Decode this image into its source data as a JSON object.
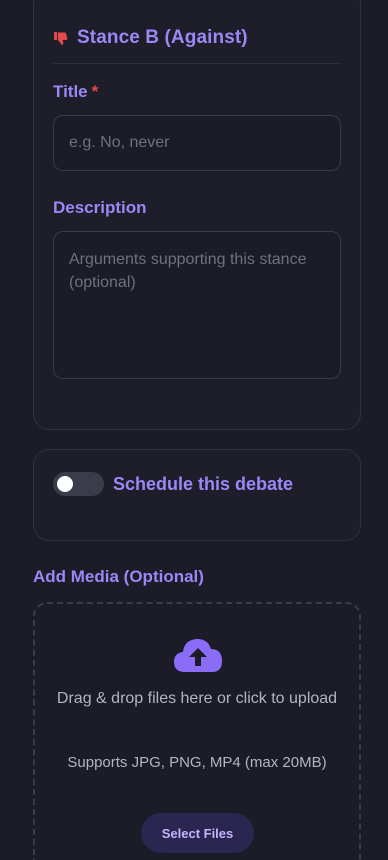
{
  "stance": {
    "icon": "thumbs-down-icon",
    "icon_color": "#e5484d",
    "heading": "Stance B (Against)",
    "title_label": "Title",
    "required_mark": "*",
    "title_placeholder": "e.g. No, never",
    "title_value": "",
    "description_label": "Description",
    "description_placeholder": "Arguments supporting this stance (optional)",
    "description_value": ""
  },
  "schedule": {
    "toggle_on": false,
    "label": "Schedule this debate"
  },
  "media": {
    "label": "Add Media (Optional)",
    "icon": "cloud-upload-icon",
    "icon_color": "#8b6cf6",
    "drop_text": "Drag & drop files here or click to upload",
    "support_text": "Supports JPG, PNG, MP4 (max 20MB)",
    "button_label": "Select Files"
  },
  "colors": {
    "accent": "#9b87f5",
    "background": "#1b1c27",
    "card": "#1d1e2a",
    "required": "#e5484d"
  }
}
